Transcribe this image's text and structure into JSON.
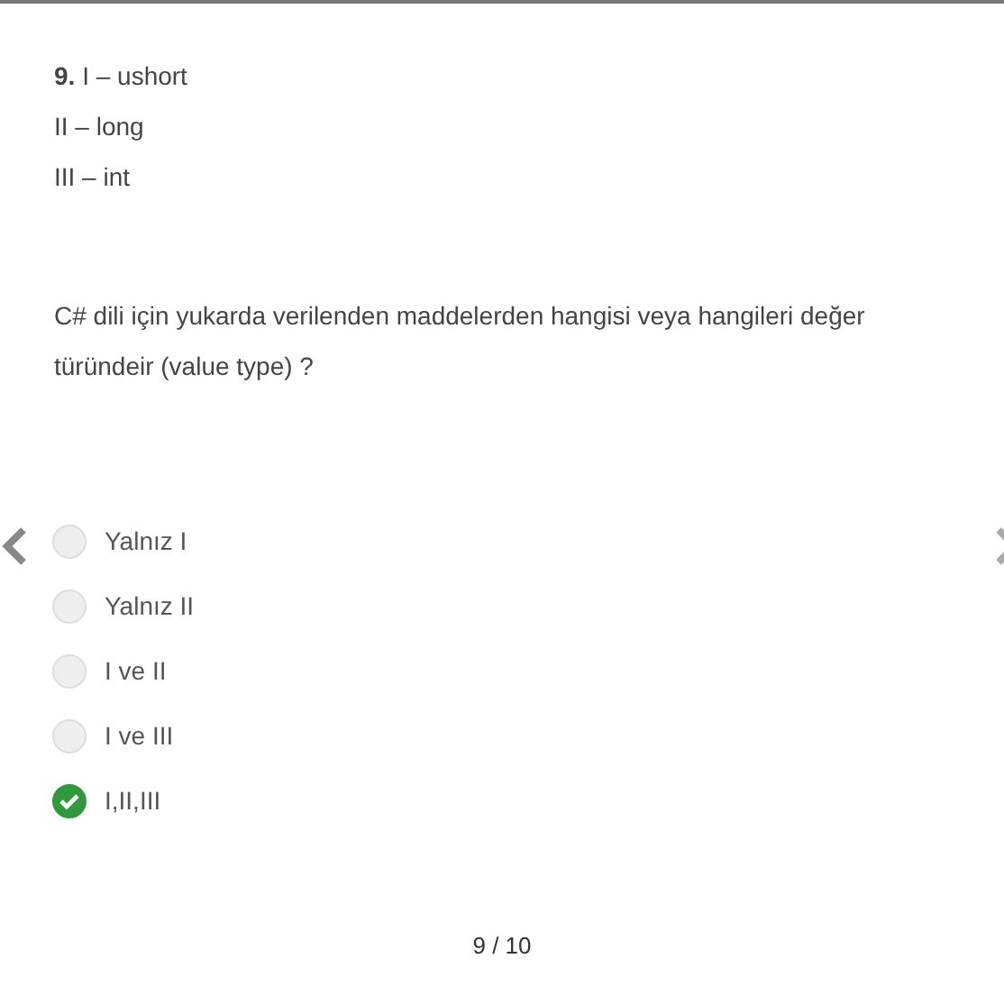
{
  "question": {
    "lines": [
      "**9.** I – ushort",
      "II – long",
      "III – int"
    ],
    "prompt": "C# dili için yukarda verilenden maddelerden hangisi veya hangileri değer türündeir (value type) ?"
  },
  "options": [
    {
      "label": "Yalnız I",
      "selected": false
    },
    {
      "label": "Yalnız II",
      "selected": false
    },
    {
      "label": "I ve II",
      "selected": false
    },
    {
      "label": "I ve III",
      "selected": false
    },
    {
      "label": "I,II,III",
      "selected": true
    }
  ],
  "pager": "9 / 10"
}
